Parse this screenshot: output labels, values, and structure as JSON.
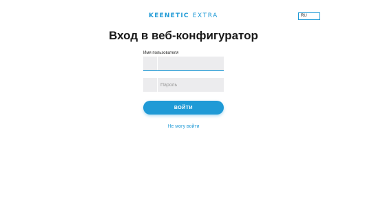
{
  "header": {
    "brand": "KEENETIC",
    "model": "EXTRA",
    "language": "RU"
  },
  "login": {
    "title": "Вход в веб-конфигуратор",
    "username_label": "Имя пользователя",
    "username_value": "",
    "password_placeholder": "Пароль",
    "password_value": "",
    "submit_label": "ВОЙТИ",
    "forgot_link": "Не могу войти"
  },
  "colors": {
    "accent": "#1f9ad6",
    "field_bg": "#ececee",
    "text": "#1a1a1a"
  }
}
